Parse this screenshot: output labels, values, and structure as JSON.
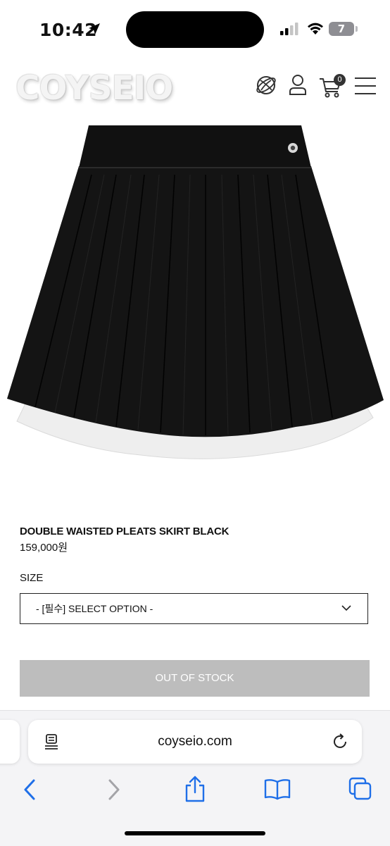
{
  "status_bar": {
    "time": "10:42",
    "battery_level": "7"
  },
  "header": {
    "logo_text": "COYSEIO",
    "icons": [
      "globe-icon",
      "user-icon",
      "cart-icon",
      "menu-icon"
    ],
    "cart_count": "0"
  },
  "product": {
    "name": "DOUBLE WAISTED PLEATS SKIRT BLACK",
    "price": "159,000원",
    "size_label": "SIZE",
    "size_select_value": "- [필수] SELECT OPTION -",
    "out_of_stock_label": "OUT OF STOCK"
  },
  "browser": {
    "url": "coyseio.com",
    "toolbar_icons": [
      "back-icon",
      "forward-icon",
      "share-icon",
      "bookmarks-icon",
      "tabs-icon"
    ]
  },
  "colors": {
    "out_of_stock_bg": "#bdbdbd",
    "skirt": "#141414",
    "underlayer": "#eeeeee"
  }
}
